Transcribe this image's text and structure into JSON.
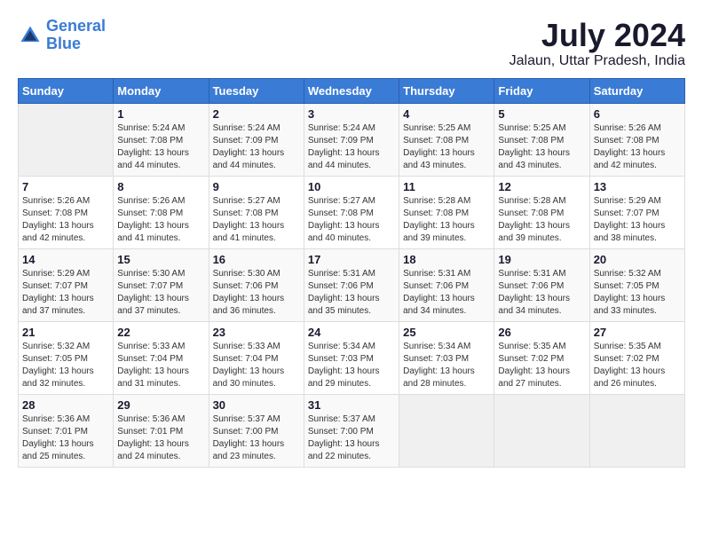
{
  "logo": {
    "line1": "General",
    "line2": "Blue"
  },
  "title": {
    "month_year": "July 2024",
    "location": "Jalaun, Uttar Pradesh, India"
  },
  "headers": [
    "Sunday",
    "Monday",
    "Tuesday",
    "Wednesday",
    "Thursday",
    "Friday",
    "Saturday"
  ],
  "weeks": [
    [
      {
        "num": "",
        "sunrise": "",
        "sunset": "",
        "daylight": ""
      },
      {
        "num": "1",
        "sunrise": "Sunrise: 5:24 AM",
        "sunset": "Sunset: 7:08 PM",
        "daylight": "Daylight: 13 hours and 44 minutes."
      },
      {
        "num": "2",
        "sunrise": "Sunrise: 5:24 AM",
        "sunset": "Sunset: 7:09 PM",
        "daylight": "Daylight: 13 hours and 44 minutes."
      },
      {
        "num": "3",
        "sunrise": "Sunrise: 5:24 AM",
        "sunset": "Sunset: 7:09 PM",
        "daylight": "Daylight: 13 hours and 44 minutes."
      },
      {
        "num": "4",
        "sunrise": "Sunrise: 5:25 AM",
        "sunset": "Sunset: 7:08 PM",
        "daylight": "Daylight: 13 hours and 43 minutes."
      },
      {
        "num": "5",
        "sunrise": "Sunrise: 5:25 AM",
        "sunset": "Sunset: 7:08 PM",
        "daylight": "Daylight: 13 hours and 43 minutes."
      },
      {
        "num": "6",
        "sunrise": "Sunrise: 5:26 AM",
        "sunset": "Sunset: 7:08 PM",
        "daylight": "Daylight: 13 hours and 42 minutes."
      }
    ],
    [
      {
        "num": "7",
        "sunrise": "Sunrise: 5:26 AM",
        "sunset": "Sunset: 7:08 PM",
        "daylight": "Daylight: 13 hours and 42 minutes."
      },
      {
        "num": "8",
        "sunrise": "Sunrise: 5:26 AM",
        "sunset": "Sunset: 7:08 PM",
        "daylight": "Daylight: 13 hours and 41 minutes."
      },
      {
        "num": "9",
        "sunrise": "Sunrise: 5:27 AM",
        "sunset": "Sunset: 7:08 PM",
        "daylight": "Daylight: 13 hours and 41 minutes."
      },
      {
        "num": "10",
        "sunrise": "Sunrise: 5:27 AM",
        "sunset": "Sunset: 7:08 PM",
        "daylight": "Daylight: 13 hours and 40 minutes."
      },
      {
        "num": "11",
        "sunrise": "Sunrise: 5:28 AM",
        "sunset": "Sunset: 7:08 PM",
        "daylight": "Daylight: 13 hours and 39 minutes."
      },
      {
        "num": "12",
        "sunrise": "Sunrise: 5:28 AM",
        "sunset": "Sunset: 7:08 PM",
        "daylight": "Daylight: 13 hours and 39 minutes."
      },
      {
        "num": "13",
        "sunrise": "Sunrise: 5:29 AM",
        "sunset": "Sunset: 7:07 PM",
        "daylight": "Daylight: 13 hours and 38 minutes."
      }
    ],
    [
      {
        "num": "14",
        "sunrise": "Sunrise: 5:29 AM",
        "sunset": "Sunset: 7:07 PM",
        "daylight": "Daylight: 13 hours and 37 minutes."
      },
      {
        "num": "15",
        "sunrise": "Sunrise: 5:30 AM",
        "sunset": "Sunset: 7:07 PM",
        "daylight": "Daylight: 13 hours and 37 minutes."
      },
      {
        "num": "16",
        "sunrise": "Sunrise: 5:30 AM",
        "sunset": "Sunset: 7:06 PM",
        "daylight": "Daylight: 13 hours and 36 minutes."
      },
      {
        "num": "17",
        "sunrise": "Sunrise: 5:31 AM",
        "sunset": "Sunset: 7:06 PM",
        "daylight": "Daylight: 13 hours and 35 minutes."
      },
      {
        "num": "18",
        "sunrise": "Sunrise: 5:31 AM",
        "sunset": "Sunset: 7:06 PM",
        "daylight": "Daylight: 13 hours and 34 minutes."
      },
      {
        "num": "19",
        "sunrise": "Sunrise: 5:31 AM",
        "sunset": "Sunset: 7:06 PM",
        "daylight": "Daylight: 13 hours and 34 minutes."
      },
      {
        "num": "20",
        "sunrise": "Sunrise: 5:32 AM",
        "sunset": "Sunset: 7:05 PM",
        "daylight": "Daylight: 13 hours and 33 minutes."
      }
    ],
    [
      {
        "num": "21",
        "sunrise": "Sunrise: 5:32 AM",
        "sunset": "Sunset: 7:05 PM",
        "daylight": "Daylight: 13 hours and 32 minutes."
      },
      {
        "num": "22",
        "sunrise": "Sunrise: 5:33 AM",
        "sunset": "Sunset: 7:04 PM",
        "daylight": "Daylight: 13 hours and 31 minutes."
      },
      {
        "num": "23",
        "sunrise": "Sunrise: 5:33 AM",
        "sunset": "Sunset: 7:04 PM",
        "daylight": "Daylight: 13 hours and 30 minutes."
      },
      {
        "num": "24",
        "sunrise": "Sunrise: 5:34 AM",
        "sunset": "Sunset: 7:03 PM",
        "daylight": "Daylight: 13 hours and 29 minutes."
      },
      {
        "num": "25",
        "sunrise": "Sunrise: 5:34 AM",
        "sunset": "Sunset: 7:03 PM",
        "daylight": "Daylight: 13 hours and 28 minutes."
      },
      {
        "num": "26",
        "sunrise": "Sunrise: 5:35 AM",
        "sunset": "Sunset: 7:02 PM",
        "daylight": "Daylight: 13 hours and 27 minutes."
      },
      {
        "num": "27",
        "sunrise": "Sunrise: 5:35 AM",
        "sunset": "Sunset: 7:02 PM",
        "daylight": "Daylight: 13 hours and 26 minutes."
      }
    ],
    [
      {
        "num": "28",
        "sunrise": "Sunrise: 5:36 AM",
        "sunset": "Sunset: 7:01 PM",
        "daylight": "Daylight: 13 hours and 25 minutes."
      },
      {
        "num": "29",
        "sunrise": "Sunrise: 5:36 AM",
        "sunset": "Sunset: 7:01 PM",
        "daylight": "Daylight: 13 hours and 24 minutes."
      },
      {
        "num": "30",
        "sunrise": "Sunrise: 5:37 AM",
        "sunset": "Sunset: 7:00 PM",
        "daylight": "Daylight: 13 hours and 23 minutes."
      },
      {
        "num": "31",
        "sunrise": "Sunrise: 5:37 AM",
        "sunset": "Sunset: 7:00 PM",
        "daylight": "Daylight: 13 hours and 22 minutes."
      },
      {
        "num": "",
        "sunrise": "",
        "sunset": "",
        "daylight": ""
      },
      {
        "num": "",
        "sunrise": "",
        "sunset": "",
        "daylight": ""
      },
      {
        "num": "",
        "sunrise": "",
        "sunset": "",
        "daylight": ""
      }
    ]
  ]
}
